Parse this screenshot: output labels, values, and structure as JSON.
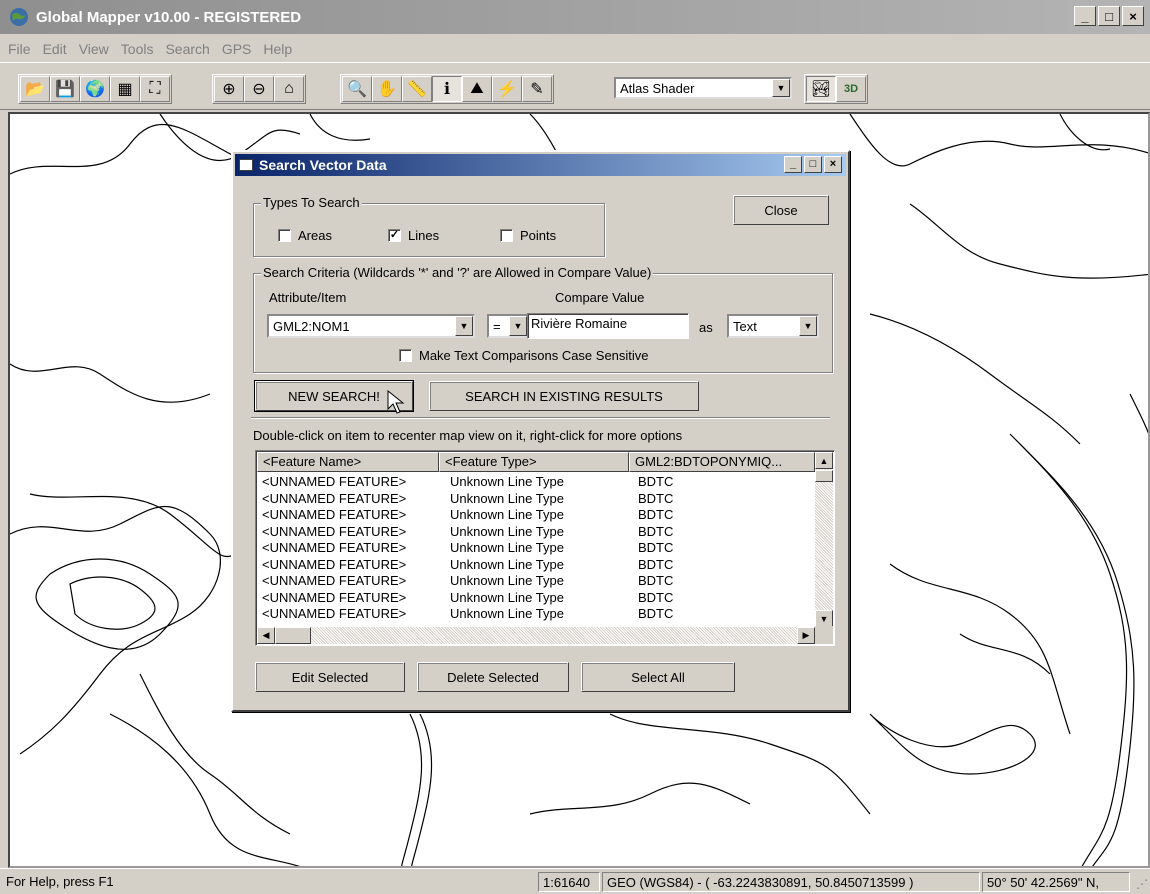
{
  "window": {
    "title": "Global Mapper v10.00 - REGISTERED",
    "min": "_",
    "max": "□",
    "close": "×"
  },
  "menu": [
    "File",
    "Edit",
    "View",
    "Tools",
    "Search",
    "GPS",
    "Help"
  ],
  "toolbar": {
    "shader": "Atlas Shader",
    "btn_3d": "3D"
  },
  "dialog": {
    "title": "Search Vector Data",
    "close_button": "Close",
    "types_group": "Types To Search",
    "types": {
      "areas": "Areas",
      "lines": "Lines",
      "points": "Points"
    },
    "types_checked": {
      "areas": false,
      "lines": true,
      "points": false
    },
    "criteria_group": "Search Criteria (Wildcards '*' and '?' are Allowed in Compare Value)",
    "attr_label": "Attribute/Item",
    "attr_value": "GML2:NOM1",
    "operator": "=",
    "compare_label": "Compare Value",
    "compare_value": "Rivière Romaine",
    "as_label": "as",
    "as_value": "Text",
    "case_label": "Make Text Comparisons Case Sensitive",
    "new_search": "NEW SEARCH!",
    "search_existing": "SEARCH IN EXISTING RESULTS",
    "hint": "Double-click on item to recenter map view on it, right-click for more options",
    "columns": [
      "<Feature Name>",
      "<Feature Type>",
      "GML2:BDTOPONYMIQ..."
    ],
    "rows": [
      [
        "<UNNAMED FEATURE>",
        "Unknown Line Type",
        "BDTC"
      ],
      [
        "<UNNAMED FEATURE>",
        "Unknown Line Type",
        "BDTC"
      ],
      [
        "<UNNAMED FEATURE>",
        "Unknown Line Type",
        "BDTC"
      ],
      [
        "<UNNAMED FEATURE>",
        "Unknown Line Type",
        "BDTC"
      ],
      [
        "<UNNAMED FEATURE>",
        "Unknown Line Type",
        "BDTC"
      ],
      [
        "<UNNAMED FEATURE>",
        "Unknown Line Type",
        "BDTC"
      ],
      [
        "<UNNAMED FEATURE>",
        "Unknown Line Type",
        "BDTC"
      ],
      [
        "<UNNAMED FEATURE>",
        "Unknown Line Type",
        "BDTC"
      ],
      [
        "<UNNAMED FEATURE>",
        "Unknown Line Type",
        "BDTC"
      ]
    ],
    "edit_selected": "Edit Selected",
    "delete_selected": "Delete Selected",
    "select_all": "Select All"
  },
  "status": {
    "help": "For Help, press F1",
    "scale": "1:61640",
    "coords": "GEO (WGS84) - ( -63.2243830891, 50.8450713599 )",
    "dms": "50° 50' 42.2569\" N,"
  }
}
